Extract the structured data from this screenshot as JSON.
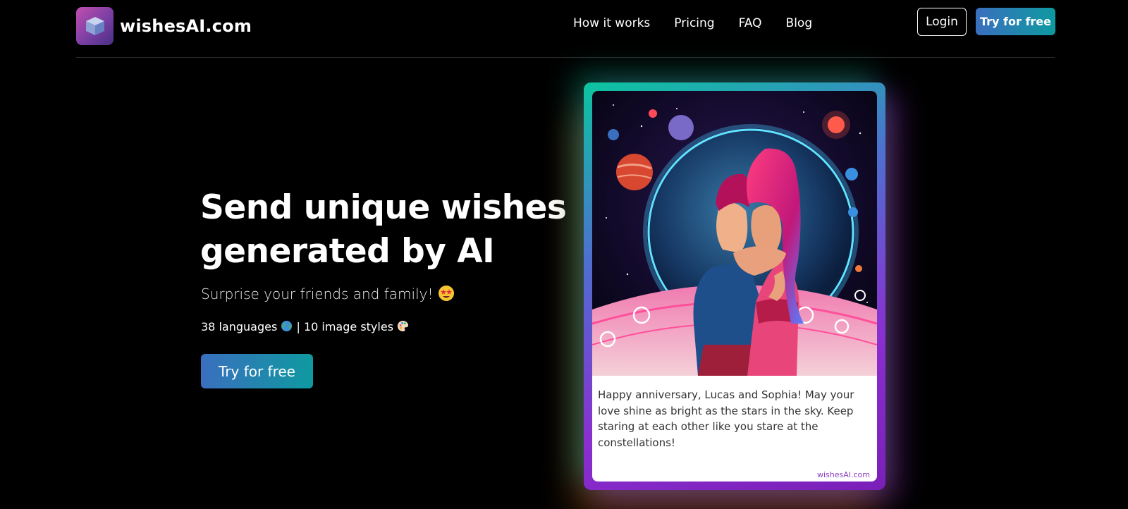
{
  "brand": {
    "name": "wishesAI.com"
  },
  "nav": {
    "links": [
      "How it works",
      "Pricing",
      "FAQ",
      "Blog"
    ],
    "login_label": "Login",
    "try_label": "Try for free"
  },
  "hero": {
    "title_line1": "Send unique wishes",
    "title_line2": "generated by AI",
    "subtitle": "Surprise your friends and family!",
    "meta_languages": "38 languages",
    "meta_separator": "|",
    "meta_styles": "10 image styles",
    "cta_label": "Try for free"
  },
  "card": {
    "message": "Happy anniversary, Lucas and Sophia! May your love shine as bright as the stars in the sky. Keep staring at each other like you stare at the constellations!",
    "watermark": "wishesAI.com"
  },
  "colors": {
    "accent_gradient_start": "#3a6fbf",
    "accent_gradient_end": "#0e9aa0",
    "background": "#000000"
  }
}
